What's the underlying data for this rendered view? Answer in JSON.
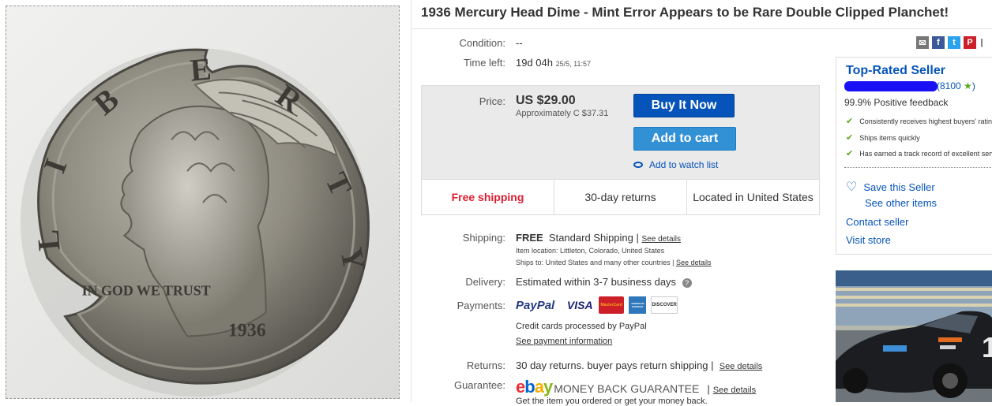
{
  "title": "1936 Mercury Head Dime - Mint Error Appears to be Rare Double Clipped Planchet!",
  "coin_image": {
    "legend_letters": [
      "L",
      "I",
      "B",
      "E",
      "R",
      "T",
      "Y"
    ],
    "motto": "IN GOD WE TRUST",
    "year": "1936"
  },
  "condition": {
    "label": "Condition:",
    "value": "--"
  },
  "time_left": {
    "label": "Time left:",
    "value": "19d 04h",
    "detail": "25/5, 11:57"
  },
  "share_icons": [
    "email-icon",
    "facebook-icon",
    "twitter-icon",
    "pinterest-icon"
  ],
  "price": {
    "label": "Price:",
    "value": "US $29.00",
    "approx": "Approximately C $37.31",
    "buy_now": "Buy It Now",
    "add_to_cart": "Add to cart",
    "watch": "Add to watch list"
  },
  "highlights": [
    "Free shipping",
    "30-day returns",
    "Located in United States"
  ],
  "shipping": {
    "label": "Shipping:",
    "free": "FREE",
    "method": "Standard Shipping |",
    "see_details": "See details",
    "location": "Item location:  Littleton, Colorado, United States",
    "ships_to": "Ships to:  United States and many other countries |",
    "ships_to_details": "See details"
  },
  "delivery": {
    "label": "Delivery:",
    "value": "Estimated within 3-7 business days",
    "help": "?"
  },
  "payments": {
    "label": "Payments:",
    "paypal": "PayPal",
    "cards": [
      "VISA",
      "MasterCard",
      "AMERICAN EXPRESS",
      "DISCOVER"
    ],
    "note": "Credit cards processed by PayPal",
    "see_info": "See payment information"
  },
  "returns": {
    "label": "Returns:",
    "value": "30 day returns. buyer pays return shipping |",
    "see_details": "See details"
  },
  "guarantee": {
    "label": "Guarantee:",
    "logo": "ebay",
    "text": "MONEY BACK GUARANTEE",
    "sep": "|",
    "see_details": "See details",
    "cutoff": "Get the item you ordered or get your money back."
  },
  "seller": {
    "badge": "Top-Rated Seller",
    "feedback_count": "(8100",
    "feedback_close": ")",
    "positive": "99.9% Positive feedback",
    "checks": [
      "Consistently receives highest buyers' ratings",
      "Ships items quickly",
      "Has earned a track record of excellent service"
    ],
    "save": "Save this Seller",
    "see_other": "See other items",
    "contact": "Contact seller",
    "visit": "Visit store"
  },
  "colors": {
    "link": "#0654ba",
    "buy": "#0654ba",
    "cart": "#3290d4",
    "free_shipping": "#dd1e31",
    "check": "#5ba71b",
    "star": "#5ba71b"
  }
}
